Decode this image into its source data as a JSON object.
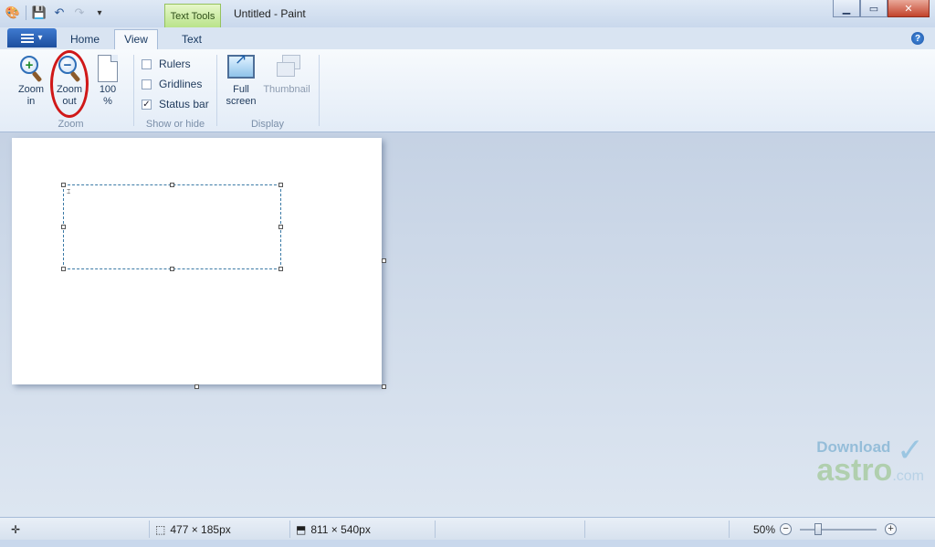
{
  "window": {
    "title": "Untitled - Paint",
    "context_tab": "Text Tools"
  },
  "tabs": [
    {
      "label": "Home",
      "active": false
    },
    {
      "label": "View",
      "active": true
    },
    {
      "label": "Text",
      "active": false
    }
  ],
  "ribbon": {
    "zoom_group": {
      "label": "Zoom",
      "zoom_in": {
        "line1": "Zoom",
        "line2": "in"
      },
      "zoom_out": {
        "line1": "Zoom",
        "line2": "out"
      },
      "hundred": {
        "line1": "100",
        "line2": "%"
      }
    },
    "show_hide_group": {
      "label": "Show or hide",
      "rulers": {
        "label": "Rulers",
        "checked": false
      },
      "gridlines": {
        "label": "Gridlines",
        "checked": false
      },
      "status_bar": {
        "label": "Status bar",
        "checked": true,
        "mark": "✓"
      }
    },
    "display_group": {
      "label": "Display",
      "full_screen": {
        "line1": "Full",
        "line2": "screen"
      },
      "thumbnail": {
        "label": "Thumbnail"
      }
    }
  },
  "statusbar": {
    "selection_size": "477 × 185px",
    "canvas_size": "811 × 540px",
    "zoom": "50%"
  },
  "watermark": {
    "top": "Download",
    "main": "astro",
    "suffix": ".com"
  },
  "icons": {
    "paint_app": "paint-app-icon",
    "save": "save-icon",
    "undo": "undo-icon",
    "redo": "redo-icon",
    "customize": "chevron-down-icon",
    "help": "help-icon"
  }
}
